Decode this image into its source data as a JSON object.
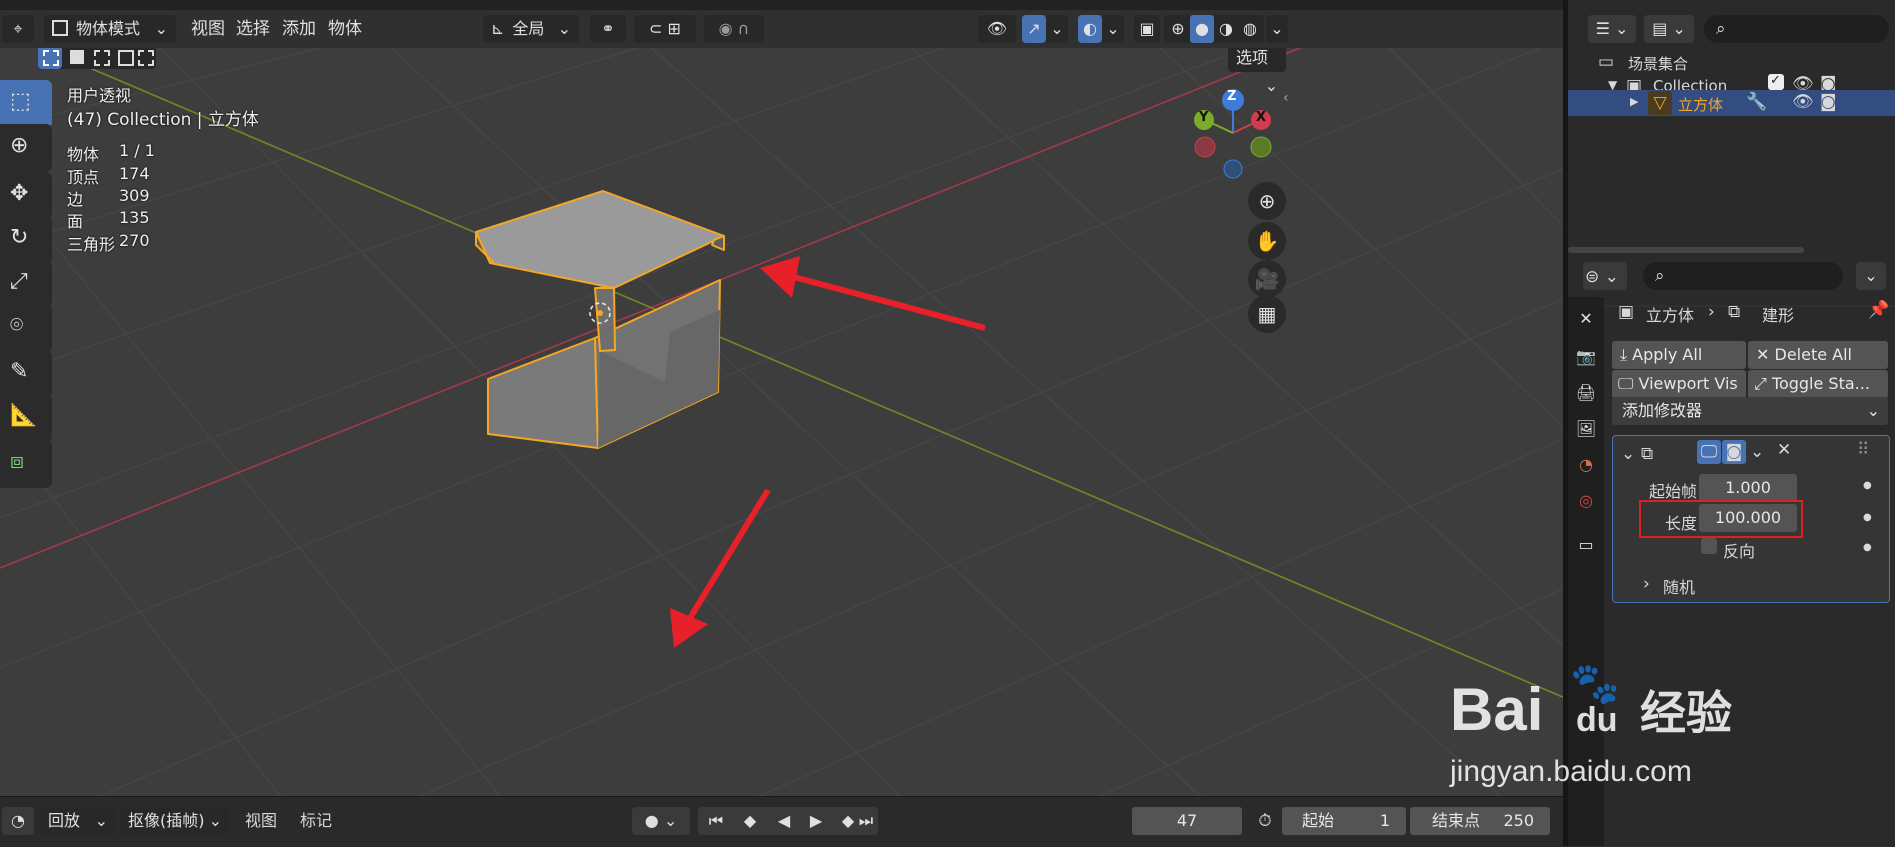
{
  "header": {
    "mode": "物体模式",
    "menus": [
      "视图",
      "选择",
      "添加",
      "物体"
    ],
    "transform_orientation": "全局",
    "options_label": "选项"
  },
  "viewport": {
    "view_name": "用户透视",
    "collection_info": "(47) Collection | 立方体",
    "stats": [
      {
        "label": "物体",
        "value": "1 / 1"
      },
      {
        "label": "顶点",
        "value": "174"
      },
      {
        "label": "边",
        "value": "309"
      },
      {
        "label": "面",
        "value": "135"
      },
      {
        "label": "三角形",
        "value": "270"
      }
    ],
    "gizmo": {
      "z": "Z",
      "y": "Y",
      "x": "X"
    }
  },
  "timeline": {
    "playback": "回放",
    "keying": "抠像(插帧)",
    "view": "视图",
    "marker": "标记",
    "current_frame": "47",
    "start_label": "起始",
    "start_value": "1",
    "end_label": "结束点",
    "end_value": "250"
  },
  "outliner": {
    "scene_collection": "场景集合",
    "collection": "Collection",
    "object": "立方体"
  },
  "properties": {
    "breadcrumb_object": "立方体",
    "breadcrumb_modifier": "建形",
    "apply_all": "Apply All",
    "delete_all": "Delete All",
    "viewport_vis": "Viewport Vis",
    "toggle_stack": "Toggle Sta...",
    "add_modifier": "添加修改器",
    "start_frame_label": "起始帧",
    "start_frame_value": "1.000",
    "length_label": "长度",
    "length_value": "100.000",
    "reverse_label": "反向",
    "random_label": "随机"
  },
  "watermark": {
    "brand": "Bai",
    "brand2": "du",
    "jingyan": "经验",
    "url": "jingyan.baidu.com"
  },
  "colors": {
    "accent": "#4772b3",
    "selection_orange": "#f5a623",
    "arrow_red": "#e8202a",
    "highlight_box": "#e02020"
  }
}
